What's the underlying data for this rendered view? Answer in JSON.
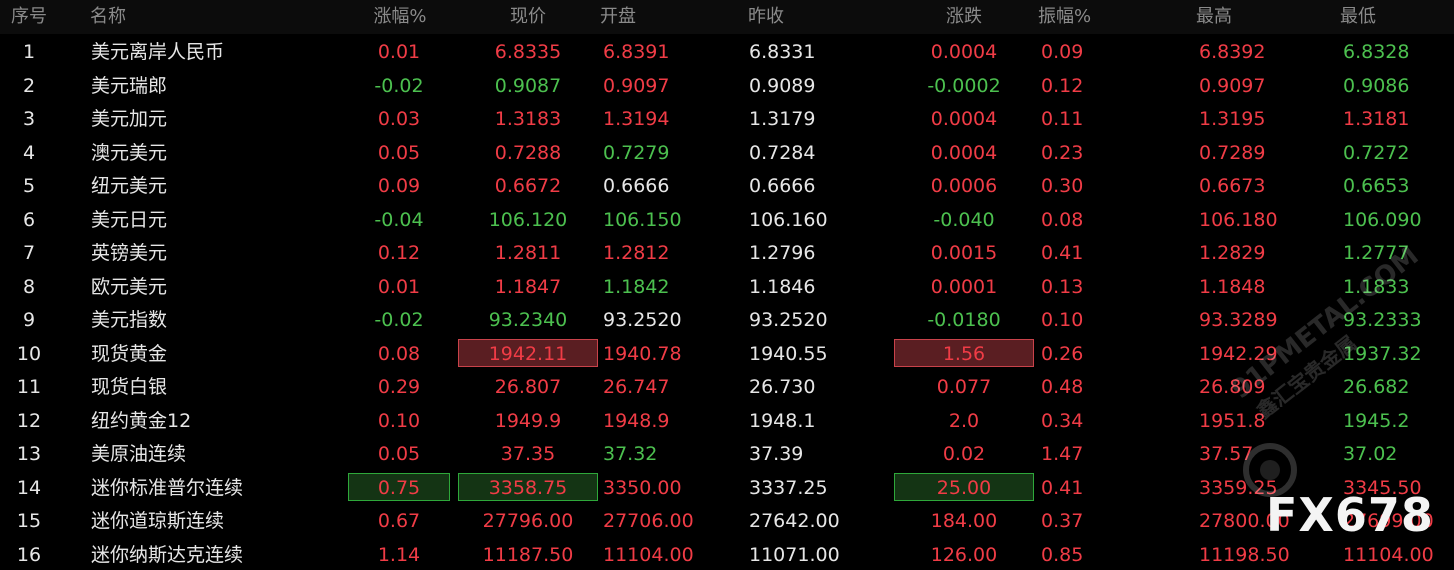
{
  "columns": [
    "序号",
    "名称",
    "涨幅%",
    "现价",
    "开盘",
    "昨收",
    "涨跌",
    "振幅%",
    "最高",
    "最低"
  ],
  "rows": [
    {
      "no": "1",
      "name": "美元离岸人民币",
      "chg_pct": "0.01",
      "price": "6.8335",
      "open": "6.8391",
      "prev": "6.8331",
      "change": "0.0004",
      "amp": "0.09",
      "high": "6.8392",
      "low": "6.8328"
    },
    {
      "no": "2",
      "name": "美元瑞郎",
      "chg_pct": "-0.02",
      "price": "0.9087",
      "open": "0.9097",
      "prev": "0.9089",
      "change": "-0.0002",
      "amp": "0.12",
      "high": "0.9097",
      "low": "0.9086"
    },
    {
      "no": "3",
      "name": "美元加元",
      "chg_pct": "0.03",
      "price": "1.3183",
      "open": "1.3194",
      "prev": "1.3179",
      "change": "0.0004",
      "amp": "0.11",
      "high": "1.3195",
      "low": "1.3181"
    },
    {
      "no": "4",
      "name": "澳元美元",
      "chg_pct": "0.05",
      "price": "0.7288",
      "open": "0.7279",
      "prev": "0.7284",
      "change": "0.0004",
      "amp": "0.23",
      "high": "0.7289",
      "low": "0.7272"
    },
    {
      "no": "5",
      "name": "纽元美元",
      "chg_pct": "0.09",
      "price": "0.6672",
      "open": "0.6666",
      "prev": "0.6666",
      "change": "0.0006",
      "amp": "0.30",
      "high": "0.6673",
      "low": "0.6653"
    },
    {
      "no": "6",
      "name": "美元日元",
      "chg_pct": "-0.04",
      "price": "106.120",
      "open": "106.150",
      "prev": "106.160",
      "change": "-0.040",
      "amp": "0.08",
      "high": "106.180",
      "low": "106.090"
    },
    {
      "no": "7",
      "name": "英镑美元",
      "chg_pct": "0.12",
      "price": "1.2811",
      "open": "1.2812",
      "prev": "1.2796",
      "change": "0.0015",
      "amp": "0.41",
      "high": "1.2829",
      "low": "1.2777"
    },
    {
      "no": "8",
      "name": "欧元美元",
      "chg_pct": "0.01",
      "price": "1.1847",
      "open": "1.1842",
      "prev": "1.1846",
      "change": "0.0001",
      "amp": "0.13",
      "high": "1.1848",
      "low": "1.1833"
    },
    {
      "no": "9",
      "name": "美元指数",
      "chg_pct": "-0.02",
      "price": "93.2340",
      "open": "93.2520",
      "prev": "93.2520",
      "change": "-0.0180",
      "amp": "0.10",
      "high": "93.3289",
      "low": "93.2333"
    },
    {
      "no": "10",
      "name": "现货黄金",
      "chg_pct": "0.08",
      "price": "1942.11",
      "open": "1940.78",
      "prev": "1940.55",
      "change": "1.56",
      "amp": "0.26",
      "high": "1942.29",
      "low": "1937.32"
    },
    {
      "no": "11",
      "name": "现货白银",
      "chg_pct": "0.29",
      "price": "26.807",
      "open": "26.747",
      "prev": "26.730",
      "change": "0.077",
      "amp": "0.48",
      "high": "26.809",
      "low": "26.682"
    },
    {
      "no": "12",
      "name": "纽约黄金12",
      "chg_pct": "0.10",
      "price": "1949.9",
      "open": "1948.9",
      "prev": "1948.1",
      "change": "2.0",
      "amp": "0.34",
      "high": "1951.8",
      "low": "1945.2"
    },
    {
      "no": "13",
      "name": "美原油连续",
      "chg_pct": "0.05",
      "price": "37.35",
      "open": "37.32",
      "prev": "37.39",
      "change": "0.02",
      "amp": "1.47",
      "high": "37.57",
      "low": "37.02"
    },
    {
      "no": "14",
      "name": "迷你标准普尔连续",
      "chg_pct": "0.75",
      "price": "3358.75",
      "open": "3350.00",
      "prev": "3337.25",
      "change": "25.00",
      "amp": "0.41",
      "high": "3359.25",
      "low": "3345.50"
    },
    {
      "no": "15",
      "name": "迷你道琼斯连续",
      "chg_pct": "0.67",
      "price": "27796.00",
      "open": "27706.00",
      "prev": "27642.00",
      "change": "184.00",
      "amp": "0.37",
      "high": "27800.00",
      "low": "27699.00"
    },
    {
      "no": "16",
      "name": "迷你纳斯达克连续",
      "chg_pct": "1.14",
      "price": "11187.50",
      "open": "11104.00",
      "prev": "11071.00",
      "change": "126.00",
      "amp": "0.85",
      "high": "11198.50",
      "low": "11104.00"
    }
  ],
  "cell_colors": [
    {
      "chg_pct": "red",
      "price": "red",
      "open": "red",
      "prev": "white",
      "change": "red",
      "amp": "red",
      "high": "red",
      "low": "green"
    },
    {
      "chg_pct": "green",
      "price": "green",
      "open": "red",
      "prev": "white",
      "change": "green",
      "amp": "red",
      "high": "red",
      "low": "green"
    },
    {
      "chg_pct": "red",
      "price": "red",
      "open": "red",
      "prev": "white",
      "change": "red",
      "amp": "red",
      "high": "red",
      "low": "red"
    },
    {
      "chg_pct": "red",
      "price": "red",
      "open": "green",
      "prev": "white",
      "change": "red",
      "amp": "red",
      "high": "red",
      "low": "green"
    },
    {
      "chg_pct": "red",
      "price": "red",
      "open": "white",
      "prev": "white",
      "change": "red",
      "amp": "red",
      "high": "red",
      "low": "green"
    },
    {
      "chg_pct": "green",
      "price": "green",
      "open": "green",
      "prev": "white",
      "change": "green",
      "amp": "red",
      "high": "red",
      "low": "green"
    },
    {
      "chg_pct": "red",
      "price": "red",
      "open": "red",
      "prev": "white",
      "change": "red",
      "amp": "red",
      "high": "red",
      "low": "green"
    },
    {
      "chg_pct": "red",
      "price": "red",
      "open": "green",
      "prev": "white",
      "change": "red",
      "amp": "red",
      "high": "red",
      "low": "green"
    },
    {
      "chg_pct": "green",
      "price": "green",
      "open": "white",
      "prev": "white",
      "change": "green",
      "amp": "red",
      "high": "red",
      "low": "green"
    },
    {
      "chg_pct": "red",
      "price": "red",
      "open": "red",
      "prev": "white",
      "change": "red",
      "amp": "red",
      "high": "red",
      "low": "green"
    },
    {
      "chg_pct": "red",
      "price": "red",
      "open": "red",
      "prev": "white",
      "change": "red",
      "amp": "red",
      "high": "red",
      "low": "green"
    },
    {
      "chg_pct": "red",
      "price": "red",
      "open": "red",
      "prev": "white",
      "change": "red",
      "amp": "red",
      "high": "red",
      "low": "green"
    },
    {
      "chg_pct": "red",
      "price": "red",
      "open": "green",
      "prev": "white",
      "change": "red",
      "amp": "red",
      "high": "red",
      "low": "green"
    },
    {
      "chg_pct": "red",
      "price": "red",
      "open": "red",
      "prev": "white",
      "change": "red",
      "amp": "red",
      "high": "red",
      "low": "red"
    },
    {
      "chg_pct": "red",
      "price": "red",
      "open": "red",
      "prev": "white",
      "change": "red",
      "amp": "red",
      "high": "red",
      "low": "red"
    },
    {
      "chg_pct": "red",
      "price": "red",
      "open": "red",
      "prev": "white",
      "change": "red",
      "amp": "red",
      "high": "red",
      "low": "red"
    }
  ],
  "highlights": [
    {
      "row": 9,
      "field": "price",
      "style": "hl-red"
    },
    {
      "row": 9,
      "field": "change",
      "style": "hl-red"
    },
    {
      "row": 13,
      "field": "chg_pct",
      "style": "hl-green"
    },
    {
      "row": 13,
      "field": "price",
      "style": "hl-green"
    },
    {
      "row": 13,
      "field": "change",
      "style": "hl-green"
    }
  ],
  "colors": {
    "up": "#f03c46",
    "down": "#4cc04f",
    "neutral": "#e6e6e6",
    "header_text": "#8a8a8a",
    "background": "#000000"
  },
  "watermark": {
    "site": "91PMETAL.COM",
    "site_cn": "鑫汇宝贵金属",
    "brand": "FX678"
  }
}
